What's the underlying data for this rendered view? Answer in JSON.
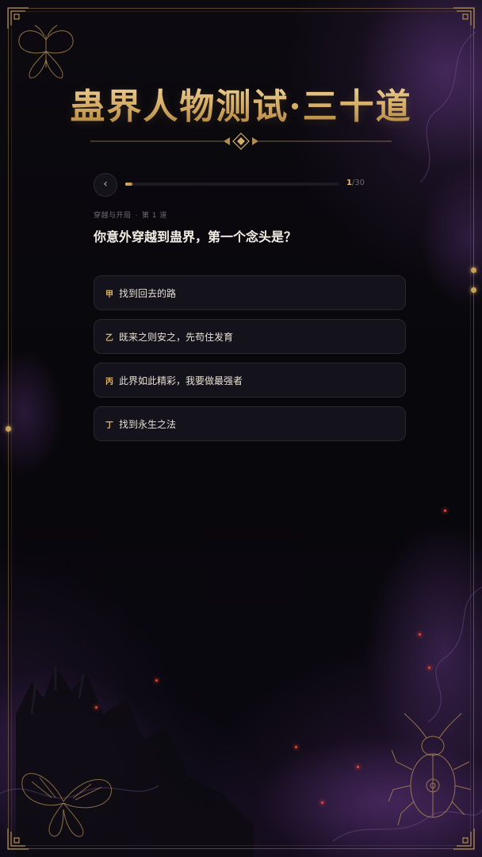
{
  "page": {
    "title": "蛊界人物测试·三十道"
  },
  "nav": {
    "back_icon": "chevron-left-icon",
    "back_label": "‹",
    "progress": {
      "current": "1",
      "total_text": "/30",
      "fraction": 0.0333
    }
  },
  "question": {
    "section": "穿越与开局",
    "separator": "·",
    "number_label": "第 1 道",
    "text": "你意外穿越到蛊界，第一个念头是？"
  },
  "options": [
    {
      "badge": "甲",
      "label": "找到回去的路"
    },
    {
      "badge": "乙",
      "label": "既来之则安之，先苟住发育"
    },
    {
      "badge": "丙",
      "label": "此界如此精彩，我要做最强者"
    },
    {
      "badge": "丁",
      "label": "找到永生之法"
    }
  ],
  "colors": {
    "accent_gold": "#d9b36b",
    "background": "#08070b",
    "ember_red": "#e04a3a",
    "smoke_purple": "#5a3278"
  }
}
